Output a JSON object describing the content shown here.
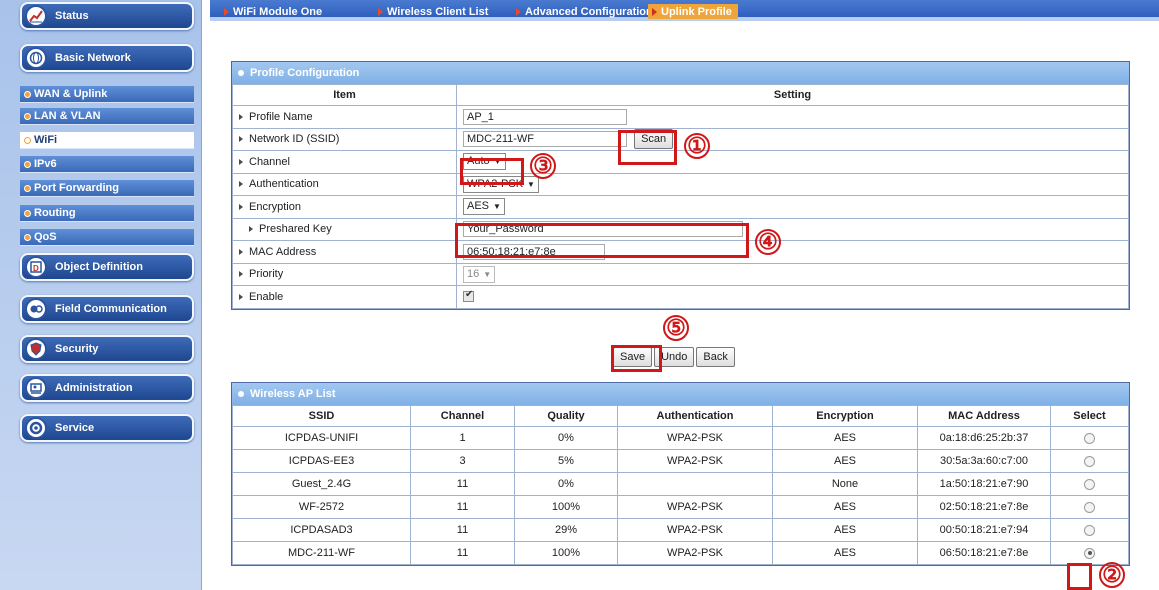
{
  "sidebar": {
    "status": "Status",
    "basic_network": "Basic Network",
    "wan_uplink": "WAN & Uplink",
    "lan_vlan": "LAN & VLAN",
    "wifi": "WiFi",
    "ipv6": "IPv6",
    "port_forwarding": "Port Forwarding",
    "routing": "Routing",
    "qos": "QoS",
    "object_definition": "Object Definition",
    "field_communication": "Field Communication",
    "security": "Security",
    "administration": "Administration",
    "service": "Service"
  },
  "tabs": [
    "WiFi Module One",
    "Wireless Client List",
    "Advanced Configuration",
    "Uplink Profile"
  ],
  "profile": {
    "title": "Profile Configuration",
    "col_item": "Item",
    "col_setting": "Setting",
    "profile_name_label": "Profile Name",
    "profile_name_value": "AP_1",
    "ssid_label": "Network ID (SSID)",
    "ssid_value": "MDC-211-WF",
    "scan_button": "Scan",
    "channel_label": "Channel",
    "channel_value": "Auto",
    "authentication_label": "Authentication",
    "authentication_value": "WPA2-PSK",
    "encryption_label": "Encryption",
    "encryption_value": "AES",
    "preshared_key_label": "Preshared Key",
    "preshared_key_value": "Your_Password",
    "mac_label": "MAC Address",
    "mac_value": "06:50:18:21:e7:8e",
    "priority_label": "Priority",
    "priority_value": "16",
    "enable_label": "Enable",
    "enable_checked": true
  },
  "actions": {
    "save": "Save",
    "undo": "Undo",
    "back": "Back"
  },
  "ap_list": {
    "title": "Wireless AP List",
    "headers": [
      "SSID",
      "Channel",
      "Quality",
      "Authentication",
      "Encryption",
      "MAC Address",
      "Select"
    ],
    "rows": [
      {
        "ssid": "ICPDAS-UNIFI",
        "channel": "1",
        "quality": "0%",
        "auth": "WPA2-PSK",
        "enc": "AES",
        "mac": "0a:18:d6:25:2b:37",
        "selected": false
      },
      {
        "ssid": "ICPDAS-EE3",
        "channel": "3",
        "quality": "5%",
        "auth": "WPA2-PSK",
        "enc": "AES",
        "mac": "30:5a:3a:60:c7:00",
        "selected": false
      },
      {
        "ssid": "Guest_2.4G",
        "channel": "11",
        "quality": "0%",
        "auth": "",
        "enc": "None",
        "mac": "1a:50:18:21:e7:90",
        "selected": false
      },
      {
        "ssid": "WF-2572",
        "channel": "11",
        "quality": "100%",
        "auth": "WPA2-PSK",
        "enc": "AES",
        "mac": "02:50:18:21:e7:8e",
        "selected": false
      },
      {
        "ssid": "ICPDASAD3",
        "channel": "11",
        "quality": "29%",
        "auth": "WPA2-PSK",
        "enc": "AES",
        "mac": "00:50:18:21:e7:94",
        "selected": false
      },
      {
        "ssid": "MDC-211-WF",
        "channel": "11",
        "quality": "100%",
        "auth": "WPA2-PSK",
        "enc": "AES",
        "mac": "06:50:18:21:e7:8e",
        "selected": true
      }
    ]
  },
  "annotations": [
    "①",
    "②",
    "③",
    "④",
    "⑤"
  ],
  "colors": {
    "annotation_red": "#d01818",
    "tab_active": "#f0a53a",
    "nav_blue": "#1f4790"
  }
}
